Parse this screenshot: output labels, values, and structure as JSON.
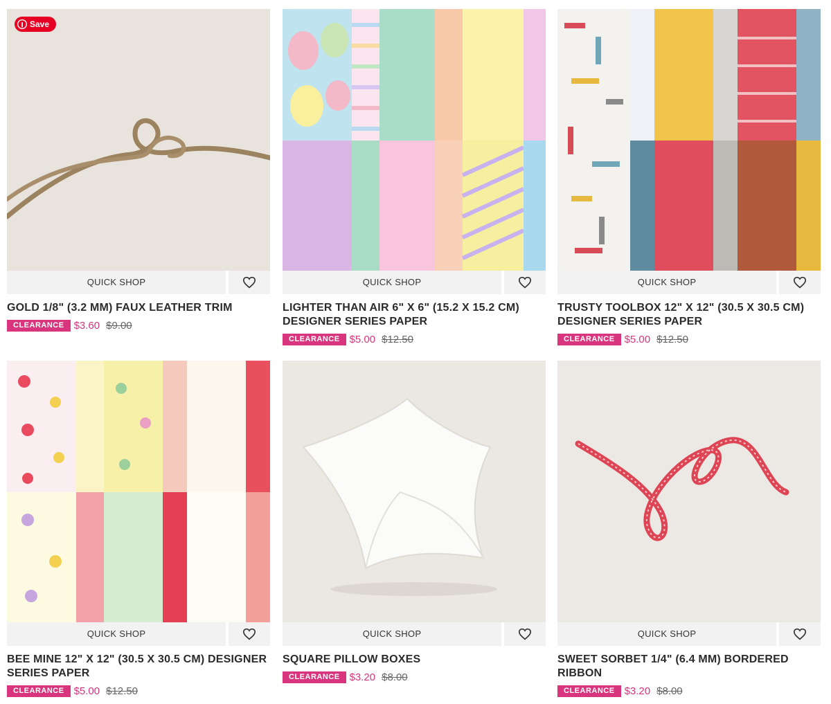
{
  "quick_shop_label": "QUICK SHOP",
  "pinterest": {
    "save_label": "Save"
  },
  "colors": {
    "clearance": "#d8357e",
    "pinterest": "#e60023"
  },
  "products": [
    {
      "title": "GOLD 1/8\" (3.2 MM) FAUX LEATHER TRIM",
      "badge": "CLEARANCE",
      "price": "$3.60",
      "old_price": "$9.00"
    },
    {
      "title": "LIGHTER THAN AIR 6\" X 6\" (15.2 X 15.2 CM) DESIGNER SERIES PAPER",
      "badge": "CLEARANCE",
      "price": "$5.00",
      "old_price": "$12.50"
    },
    {
      "title": "TRUSTY TOOLBOX 12\" X 12\" (30.5 X 30.5 CM) DESIGNER SERIES PAPER",
      "badge": "CLEARANCE",
      "price": "$5.00",
      "old_price": "$12.50"
    },
    {
      "title": "BEE MINE 12\" X 12\" (30.5 X 30.5 CM) DESIGNER SERIES PAPER",
      "badge": "CLEARANCE",
      "price": "$5.00",
      "old_price": "$12.50"
    },
    {
      "title": "SQUARE PILLOW BOXES",
      "badge": "CLEARANCE",
      "price": "$3.20",
      "old_price": "$8.00"
    },
    {
      "title": "SWEET SORBET 1/4\" (6.4 MM) BORDERED RIBBON",
      "badge": "CLEARANCE",
      "price": "$3.20",
      "old_price": "$8.00"
    }
  ]
}
